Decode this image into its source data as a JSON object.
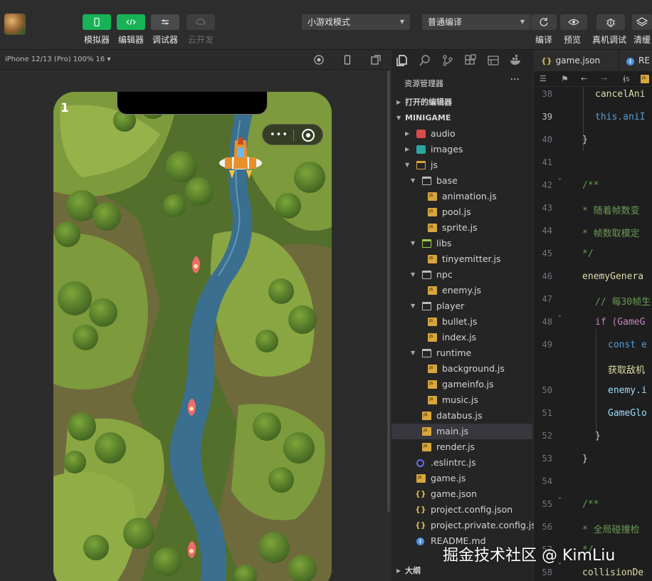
{
  "toolbar": {
    "buttons": [
      {
        "label": "模拟器"
      },
      {
        "label": "编辑器"
      },
      {
        "label": "调试器"
      },
      {
        "label": "云开发"
      }
    ],
    "mode_select": "小游戏模式",
    "compile_select": "普通编译",
    "right_buttons": [
      {
        "label": "编译"
      },
      {
        "label": "预览"
      },
      {
        "label": "真机调试"
      },
      {
        "label": "清缓"
      }
    ],
    "accent_color": "#17b356"
  },
  "simulator": {
    "device": "iPhone 12/13 (Pro) 100% 16 ▾",
    "score": "1",
    "capsule_dots": "•••"
  },
  "explorer": {
    "title": "资源管理器",
    "more": "···",
    "open_editors": "打开的编辑器",
    "project": "MINIGAME",
    "outline": "大纲",
    "items": [
      {
        "name": "audio"
      },
      {
        "name": "images"
      },
      {
        "name": "js"
      },
      {
        "name": "base"
      },
      {
        "name": "animation.js"
      },
      {
        "name": "pool.js"
      },
      {
        "name": "sprite.js"
      },
      {
        "name": "libs"
      },
      {
        "name": "tinyemitter.js"
      },
      {
        "name": "npc"
      },
      {
        "name": "enemy.js"
      },
      {
        "name": "player"
      },
      {
        "name": "bullet.js"
      },
      {
        "name": "index.js"
      },
      {
        "name": "runtime"
      },
      {
        "name": "background.js"
      },
      {
        "name": "gameinfo.js"
      },
      {
        "name": "music.js"
      },
      {
        "name": "databus.js"
      },
      {
        "name": "main.js"
      },
      {
        "name": "render.js"
      },
      {
        "name": ".eslintrc.js"
      },
      {
        "name": "game.js"
      },
      {
        "name": "game.json"
      },
      {
        "name": "project.config.json"
      },
      {
        "name": "project.private.config.js..."
      },
      {
        "name": "README.md"
      }
    ]
  },
  "editor": {
    "tabs": [
      {
        "label": "game.json"
      },
      {
        "label": "RE"
      }
    ],
    "breadcrumb": "js",
    "line_numbers": [
      "38",
      "39",
      "40",
      "41",
      "42",
      "43",
      "44",
      "45",
      "46",
      "47",
      "48",
      "49",
      "50",
      "51",
      "52",
      "53",
      "54",
      "55",
      "56",
      "57",
      "58"
    ],
    "lines": [
      {
        "text": "cancelAni"
      },
      {
        "text": "this.aniI"
      },
      {
        "text": "}"
      },
      {
        "text": ""
      },
      {
        "text": "/**"
      },
      {
        "text": " * 随着帧数变"
      },
      {
        "text": " * 帧数取模定"
      },
      {
        "text": " */"
      },
      {
        "text": "enemyGenera"
      },
      {
        "text": "// 每30帧生"
      },
      {
        "text": "if (GameG"
      },
      {
        "text": "const e"
      },
      {
        "text": "获取敌机"
      },
      {
        "text": "enemy.i"
      },
      {
        "text": "GameGlo"
      },
      {
        "text": "}"
      },
      {
        "text": "}"
      },
      {
        "text": ""
      },
      {
        "text": "/**"
      },
      {
        "text": " * 全局碰撞检"
      },
      {
        "text": " */"
      },
      {
        "text": "collisionDe"
      }
    ]
  },
  "watermark": "掘金技术社区 @ KimLiu"
}
